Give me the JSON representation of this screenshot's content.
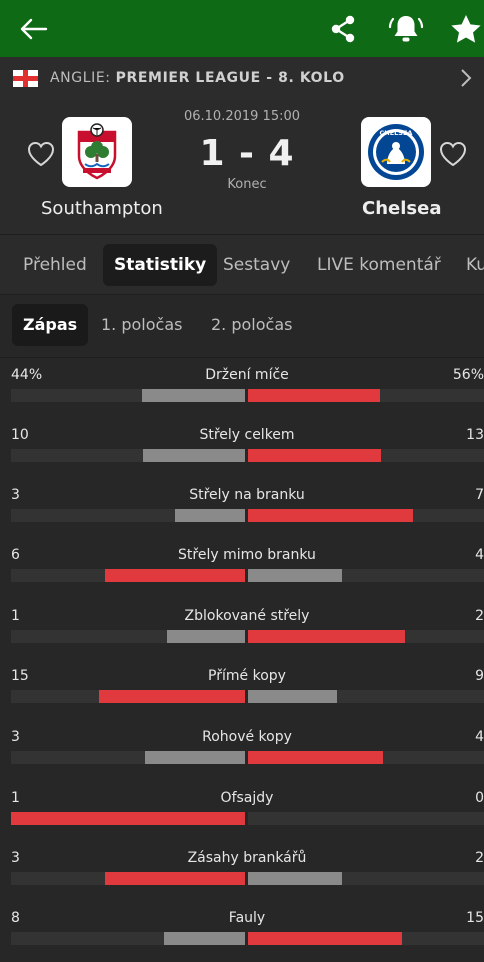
{
  "header": {
    "back_icon": "arrow-left-icon",
    "share_icon": "share-icon",
    "notify_icon": "bell-icon",
    "favorite_icon": "star-icon",
    "background": "#0f6a16"
  },
  "league": {
    "country": "ANGLIE:",
    "competition": "PREMIER LEAGUE - 8. KOLO"
  },
  "match": {
    "datetime": "06.10.2019 15:00",
    "score": "1 - 4",
    "status": "Konec",
    "home": {
      "name": "Southampton"
    },
    "away": {
      "name": "Chelsea"
    }
  },
  "tabs": [
    "Přehled",
    "Statistiky",
    "Sestavy",
    "LIVE komentář",
    "Ku"
  ],
  "periods": [
    "Zápas",
    "1. poločas",
    "2. poločas"
  ],
  "colors": {
    "winner_bar": "#e0393e",
    "loser_bar": "#8a8a8a",
    "track": "#333333"
  },
  "stats": [
    {
      "name": "Držení míče",
      "home": "44%",
      "away": "56%",
      "home_value": 44,
      "away_value": 56
    },
    {
      "name": "Střely celkem",
      "home": "10",
      "away": "13",
      "home_value": 10,
      "away_value": 13
    },
    {
      "name": "Střely na branku",
      "home": "3",
      "away": "7",
      "home_value": 3,
      "away_value": 7
    },
    {
      "name": "Střely mimo branku",
      "home": "6",
      "away": "4",
      "home_value": 6,
      "away_value": 4
    },
    {
      "name": "Zblokované střely",
      "home": "1",
      "away": "2",
      "home_value": 1,
      "away_value": 2
    },
    {
      "name": "Přímé kopy",
      "home": "15",
      "away": "9",
      "home_value": 15,
      "away_value": 9
    },
    {
      "name": "Rohové kopy",
      "home": "3",
      "away": "4",
      "home_value": 3,
      "away_value": 4
    },
    {
      "name": "Ofsajdy",
      "home": "1",
      "away": "0",
      "home_value": 1,
      "away_value": 0
    },
    {
      "name": "Zásahy brankářů",
      "home": "3",
      "away": "2",
      "home_value": 3,
      "away_value": 2
    },
    {
      "name": "Fauly",
      "home": "8",
      "away": "15",
      "home_value": 8,
      "away_value": 15
    }
  ]
}
